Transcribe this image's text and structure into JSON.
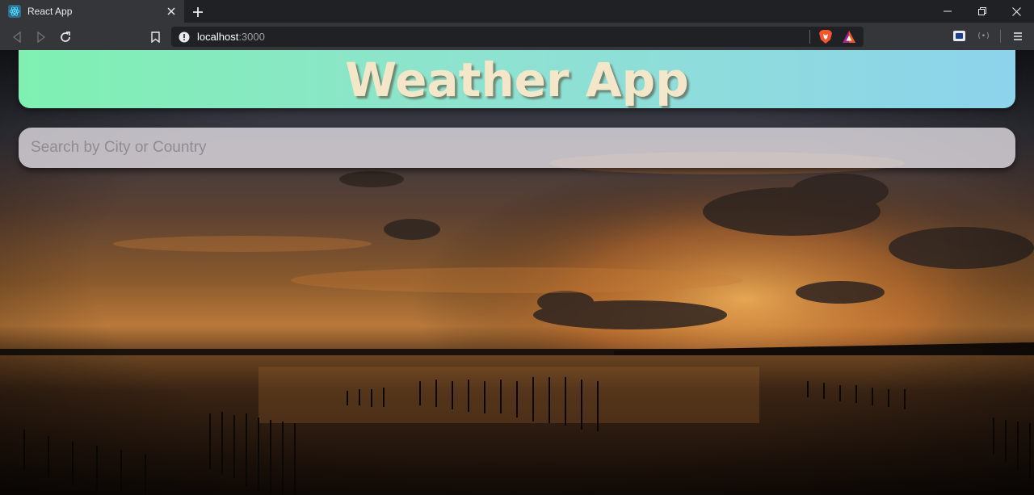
{
  "browser": {
    "tab": {
      "title": "React App",
      "favicon": "react-atom-icon"
    },
    "url": {
      "host": "localhost",
      "port": ":3000"
    },
    "window_controls": [
      "minimize-icon",
      "restore-icon",
      "close-icon"
    ]
  },
  "app": {
    "title": "Weather App",
    "search": {
      "placeholder": "Search by City or Country",
      "value": ""
    }
  },
  "colors": {
    "header_gradient_start": "#7ff0b2",
    "header_gradient_end": "#8dd3ec",
    "title_color": "#f4e6c8",
    "chrome_dark": "#202124",
    "chrome_toolbar": "#35363a"
  }
}
